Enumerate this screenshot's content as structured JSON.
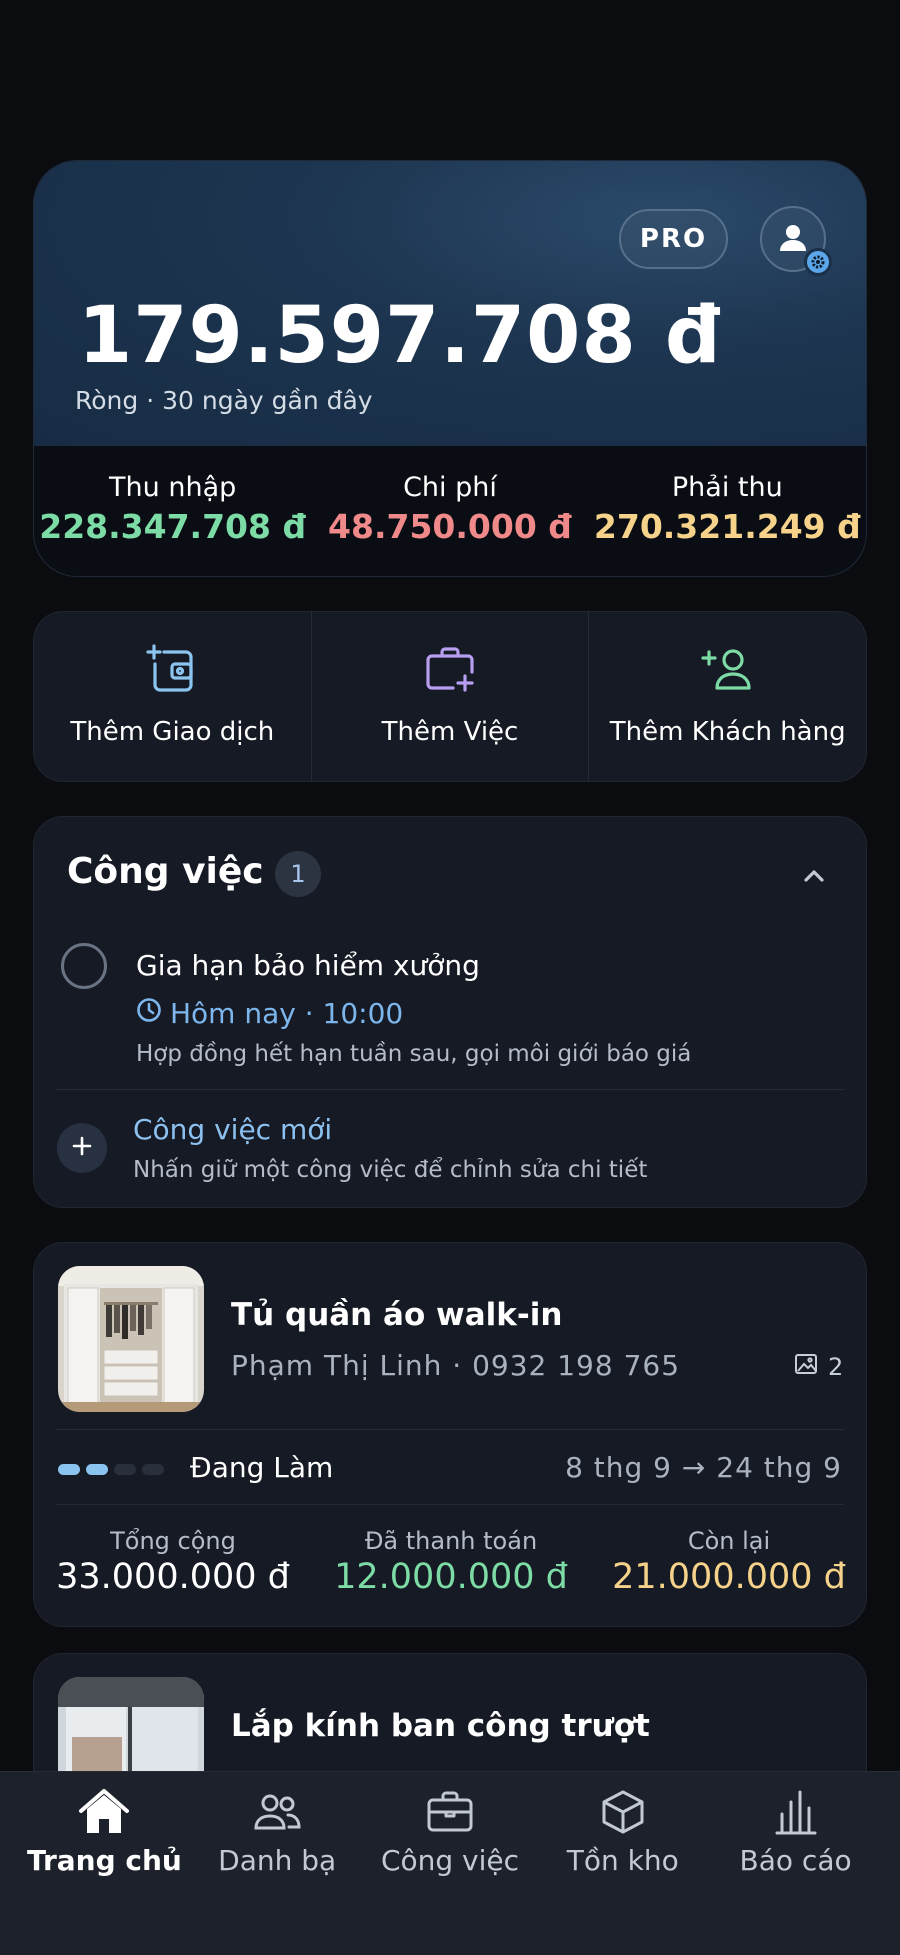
{
  "summary": {
    "pro_label": "PRO",
    "net_amount": "179.597.708 đ",
    "net_label": "Ròng · 30 ngày gần đây",
    "income_label": "Thu nhập",
    "income_value": "228.347.708 đ",
    "expense_label": "Chi phí",
    "expense_value": "48.750.000 đ",
    "receivable_label": "Phải thu",
    "receivable_value": "270.321.249 đ"
  },
  "actions": [
    {
      "label": "Thêm Giao dịch",
      "icon": "add-transaction-icon",
      "color": "#8cc4f0"
    },
    {
      "label": "Thêm Việc",
      "icon": "add-job-icon",
      "color": "#b79ef0"
    },
    {
      "label": "Thêm Khách hàng",
      "icon": "add-customer-icon",
      "color": "#7ddca6"
    }
  ],
  "tasks": {
    "title": "Công việc",
    "count": "1",
    "items": [
      {
        "title": "Gia hạn bảo hiểm xưởng",
        "time": "Hôm nay · 10:00",
        "note": "Hợp đồng hết hạn tuần sau, gọi môi giới báo giá"
      }
    ],
    "new_label": "Công việc mới",
    "new_hint": "Nhấn giữ một công việc để chỉnh sửa chi tiết"
  },
  "jobs": [
    {
      "title": "Tủ quần áo walk-in",
      "customer": "Phạm Thị Linh · 0932 198 765",
      "photo_count": "2",
      "status": "Đang Làm",
      "progress": 0.5,
      "dates": "8 thg 9 → 24 thg 9",
      "total_label": "Tổng cộng",
      "total_value": "33.000.000 đ",
      "paid_label": "Đã thanh toán",
      "paid_value": "12.000.000 đ",
      "remaining_label": "Còn lại",
      "remaining_value": "21.000.000 đ"
    },
    {
      "title": "Lắp kính ban công trượt"
    }
  ],
  "nav": [
    {
      "label": "Trang chủ",
      "icon": "home-icon",
      "active": true
    },
    {
      "label": "Danh bạ",
      "icon": "contacts-icon",
      "active": false
    },
    {
      "label": "Công việc",
      "icon": "briefcase-icon",
      "active": false
    },
    {
      "label": "Tồn kho",
      "icon": "inventory-box-icon",
      "active": false
    },
    {
      "label": "Báo cáo",
      "icon": "report-chart-icon",
      "active": false
    }
  ]
}
